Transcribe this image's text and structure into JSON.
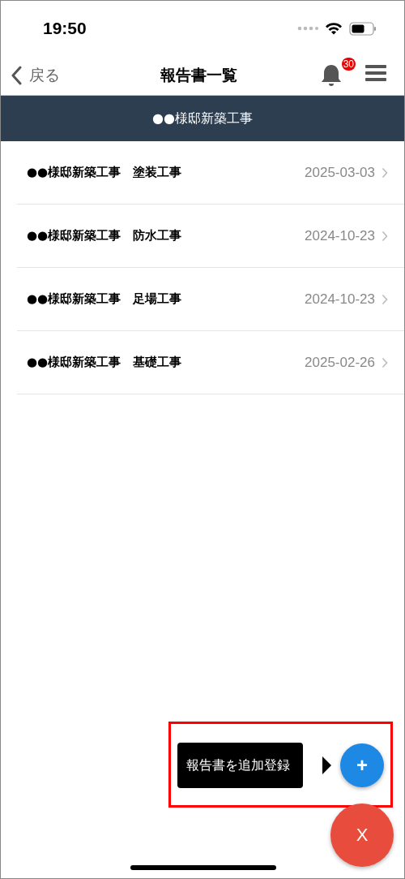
{
  "status_bar": {
    "time": "19:50"
  },
  "header": {
    "back": "戻る",
    "title": "報告書一覧",
    "notification_count": "30"
  },
  "project_band": {
    "title": "●●様邸新築工事"
  },
  "reports": [
    {
      "title": "●●様邸新築工事　塗装工事",
      "date": "2025-03-03"
    },
    {
      "title": "●●様邸新築工事　防水工事",
      "date": "2024-10-23"
    },
    {
      "title": "●●様邸新築工事　足場工事",
      "date": "2024-10-23"
    },
    {
      "title": "●●様邸新築工事　基礎工事",
      "date": "2025-02-26"
    }
  ],
  "fab_menu": {
    "tooltip": "報告書を追加登録",
    "add_symbol": "+",
    "close_symbol": "X"
  }
}
